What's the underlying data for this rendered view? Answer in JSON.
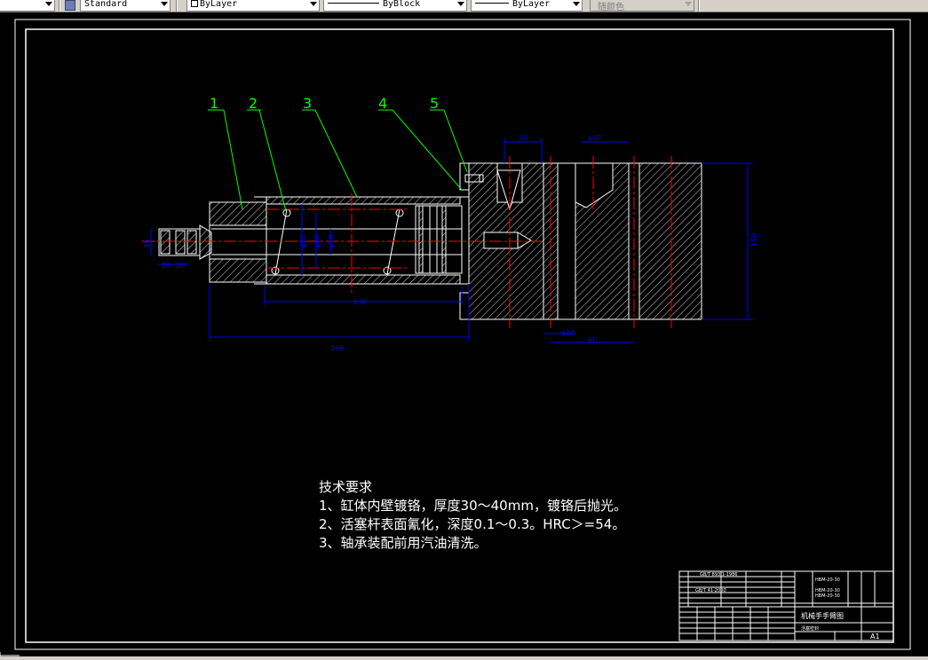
{
  "toolbar": {
    "text_style": "Standard",
    "layer": "ByLayer",
    "linetype": "ByBlock",
    "lineweight": "ByLayer",
    "plot_style": "随颜色",
    "icons": [
      "text-style-icon",
      "checkbox-icon",
      "line-sample-icon"
    ]
  },
  "drawing": {
    "balloons": [
      "1",
      "2",
      "3",
      "4",
      "5"
    ],
    "dims": {
      "d34": "34",
      "d37": "φ37",
      "d150": "150",
      "d530": "530",
      "d566": "566",
      "d10": "φ10",
      "d60": "60",
      "d35": "35",
      "d18": "18",
      "d20": "20",
      "d_a": "φ85",
      "d_b": "φ60",
      "d_c": "φ16"
    },
    "tech_requirements": {
      "title": "技术要求",
      "items": [
        "1、缸体内壁镀铬，厚度30～40mm，镀铬后抛光。",
        "2、活塞杆表面氰化，深度0.1～0.3。HRC＞=54。",
        "3、轴承装配前用汽油清洗。"
      ]
    },
    "title_block": {
      "drawing_name": "机械手手臂图",
      "sheet_size": "A1",
      "row_texts": [
        "GB/T 893.1-1986",
        "GB/T 41-2000",
        "HBM-20-30",
        "HBM-20-30",
        "HBM-20-30",
        "活塞密封"
      ]
    }
  },
  "colors": {
    "background": "#000000",
    "outline": "#ffffff",
    "leader": "#00ff00",
    "centerline": "#ff0000",
    "dimension": "#0000ff"
  }
}
